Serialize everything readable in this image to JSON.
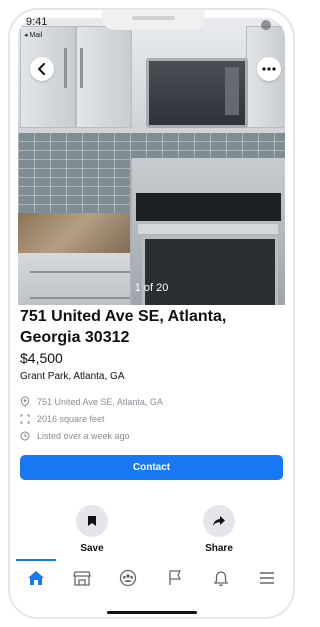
{
  "status_bar": {
    "time": "9:41",
    "back_app": "◂ Mail"
  },
  "photo": {
    "counter": "1 of 20"
  },
  "listing": {
    "address": "751 United Ave SE, Atlanta, Georgia 30312",
    "price": "$4,500",
    "neighborhood": "Grant Park, Atlanta, GA",
    "details": [
      {
        "icon": "location-pin-icon",
        "text": "751 United Ave SE, Atlanta, GA"
      },
      {
        "icon": "square-feet-icon",
        "text": "2016 square feet"
      },
      {
        "icon": "clock-icon",
        "text": "Listed over a week ago"
      }
    ]
  },
  "actions": {
    "contact_label": "Contact",
    "save_label": "Save",
    "share_label": "Share"
  },
  "tabs": [
    {
      "name": "home-tab",
      "icon": "home-icon",
      "active": true
    },
    {
      "name": "marketplace-tab",
      "icon": "storefront-icon",
      "active": false
    },
    {
      "name": "groups-tab",
      "icon": "groups-icon",
      "active": false
    },
    {
      "name": "pages-tab",
      "icon": "flag-icon",
      "active": false
    },
    {
      "name": "notifications-tab",
      "icon": "bell-icon",
      "active": false
    },
    {
      "name": "menu-tab",
      "icon": "menu-icon",
      "active": false
    }
  ],
  "colors": {
    "accent": "#1877f2",
    "icon_grey": "#65676b",
    "muted_text": "#8a8d91"
  }
}
